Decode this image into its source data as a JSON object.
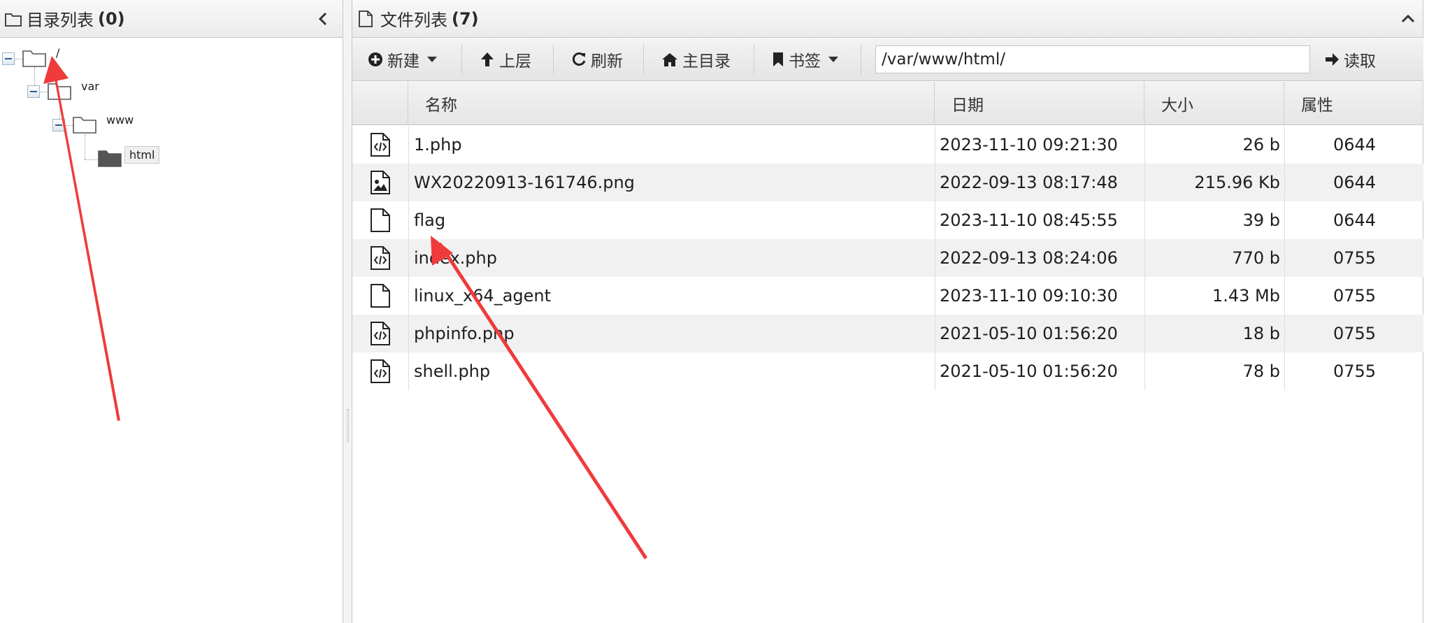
{
  "left_panel": {
    "title": "目录列表",
    "count": "(0)",
    "tree": [
      {
        "label": "/",
        "icon": "folder-outline-icon",
        "expanded": true
      },
      {
        "label": "var",
        "icon": "folder-outline-icon",
        "expanded": true
      },
      {
        "label": "www",
        "icon": "folder-outline-icon",
        "expanded": true
      },
      {
        "label": "html",
        "icon": "folder-filled-icon",
        "selected": true
      }
    ]
  },
  "right_panel": {
    "title": "文件列表",
    "count": "(7)",
    "toolbar": {
      "new_label": "新建",
      "up_label": "上层",
      "refresh_label": "刷新",
      "home_label": "主目录",
      "bookmark_label": "书签",
      "path_value": "/var/www/html/",
      "read_label": "读取"
    },
    "columns": {
      "name": "名称",
      "date": "日期",
      "size": "大小",
      "attr": "属性"
    },
    "files": [
      {
        "icon": "php-file-icon",
        "name": "1.php",
        "date": "2023-11-10 09:21:30",
        "size": "26 b",
        "attr": "0644"
      },
      {
        "icon": "image-file-icon",
        "name": "WX20220913-161746.png",
        "date": "2022-09-13 08:17:48",
        "size": "215.96 Kb",
        "attr": "0644"
      },
      {
        "icon": "blank-file-icon",
        "name": "flag",
        "date": "2023-11-10 08:45:55",
        "size": "39 b",
        "attr": "0644"
      },
      {
        "icon": "php-file-icon",
        "name": "index.php",
        "date": "2022-09-13 08:24:06",
        "size": "770 b",
        "attr": "0755"
      },
      {
        "icon": "blank-file-icon",
        "name": "linux_x64_agent",
        "date": "2023-11-10 09:10:30",
        "size": "1.43 Mb",
        "attr": "0755"
      },
      {
        "icon": "php-file-icon",
        "name": "phpinfo.php",
        "date": "2021-05-10 01:56:20",
        "size": "18 b",
        "attr": "0755"
      },
      {
        "icon": "php-file-icon",
        "name": "shell.php",
        "date": "2021-05-10 01:56:20",
        "size": "78 b",
        "attr": "0755"
      }
    ]
  },
  "colors": {
    "annotation_arrow": "#ef3b3b",
    "row_alt": "#f1f1f1",
    "header_bg": "#ebebeb"
  }
}
